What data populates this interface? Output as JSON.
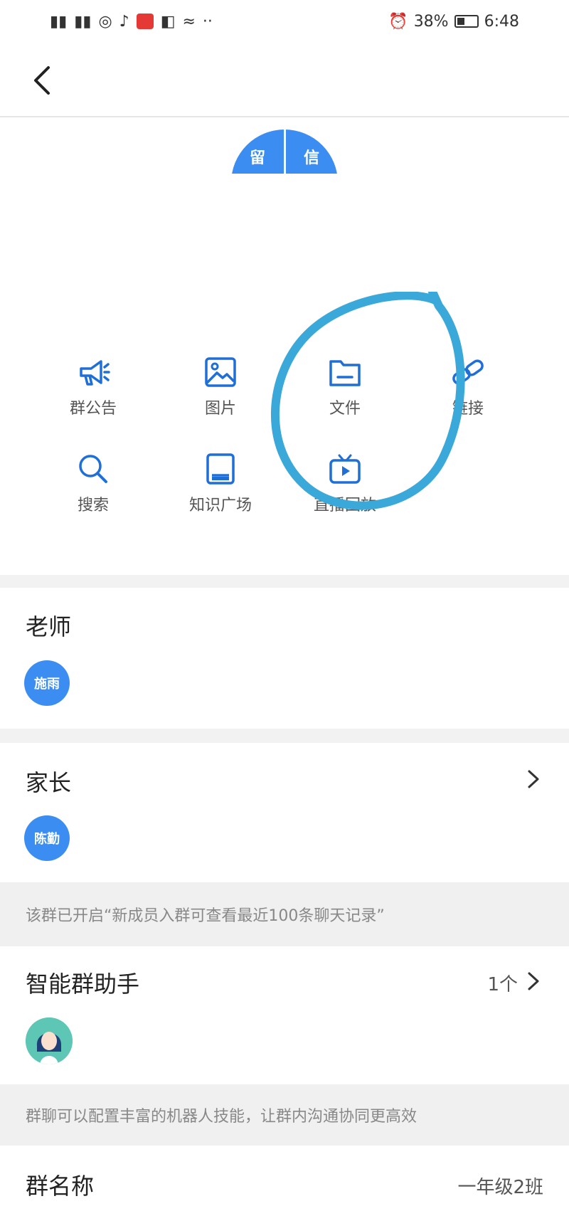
{
  "status_bar": {
    "battery": "38%",
    "time": "6:48",
    "left_icons": [
      "signal-icon",
      "signal-icon",
      "eye-icon",
      "notification-icon",
      "app-icon",
      "nfc-icon",
      "nearby-icon",
      "more-icon"
    ]
  },
  "header": {
    "back_icon": "chevron-left-icon"
  },
  "group_avatar": {
    "left": "留",
    "right": "信"
  },
  "functions": [
    {
      "id": "announcement",
      "label": "群公告",
      "icon": "megaphone-icon"
    },
    {
      "id": "images",
      "label": "图片",
      "icon": "image-icon"
    },
    {
      "id": "files",
      "label": "文件",
      "icon": "folder-icon"
    },
    {
      "id": "links",
      "label": "链接",
      "icon": "link-icon"
    },
    {
      "id": "search",
      "label": "搜索",
      "icon": "search-icon"
    },
    {
      "id": "knowledge",
      "label": "知识广场",
      "icon": "book-icon"
    },
    {
      "id": "live",
      "label": "直播回放",
      "icon": "tv-icon"
    }
  ],
  "teacher_section": {
    "title": "老师",
    "avatar_text": "施雨"
  },
  "parent_section": {
    "title": "家长",
    "avatar_text": "陈勤",
    "note": "该群已开启“新成员入群可查看最近100条聊天记录”"
  },
  "assistant_section": {
    "title": "智能群助手",
    "count": "1个",
    "note": "群聊可以配置丰富的机器人技能，让群内沟通协同更高效"
  },
  "group_name_section": {
    "title": "群名称",
    "value": "一年级2班"
  },
  "colors": {
    "accent": "#3b8df2",
    "annotation": "#3aa8d8"
  }
}
